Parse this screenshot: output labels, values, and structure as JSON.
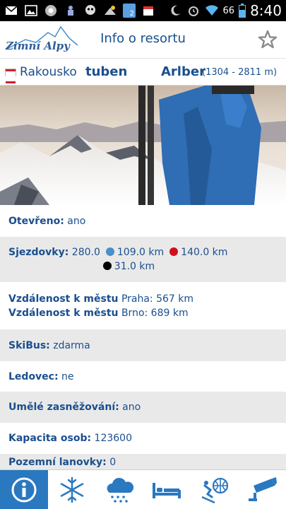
{
  "status_bar": {
    "time": "8:40",
    "battery": "66",
    "notif_badge": "2"
  },
  "header": {
    "logo_text": "Zimní Alpy",
    "title": "Info o resortu"
  },
  "location": {
    "country": "Rakousko",
    "month": "tuben",
    "resort": "Arlber",
    "elevation": "(1304 - 2811 m)"
  },
  "info": {
    "open_label": "Otevřeno:",
    "open_value": "ano",
    "slopes_label": "Sjezdovky:",
    "slopes_total": "280.0",
    "slopes_blue": "109.0 km",
    "slopes_red": "140.0 km",
    "slopes_black": "31.0 km",
    "distance_label": "Vzdálenost k městu",
    "distance_1": "Praha: 567 km",
    "distance_2": "Brno: 689 km",
    "skibus_label": "SkiBus:",
    "skibus_value": "zdarma",
    "glacier_label": "Ledovec:",
    "glacier_value": "ne",
    "snowmaking_label": "Umělé zasněžování:",
    "snowmaking_value": "ano",
    "capacity_label": "Kapacita osob:",
    "capacity_value": "123600",
    "lifts_label": "Pozemní lanovky:",
    "lifts_value": "0"
  },
  "colors": {
    "brand": "#1a4f8e",
    "active_tab": "#2a78c0",
    "blue_slope": "#4a8fc8",
    "red_slope": "#d0101a",
    "black_slope": "#000000",
    "row_grey": "#e9e9e9"
  },
  "bottom_nav": [
    {
      "icon": "info-icon"
    },
    {
      "icon": "snowflake-icon"
    },
    {
      "icon": "snow-cloud-icon"
    },
    {
      "icon": "bed-icon"
    },
    {
      "icon": "skier-globe-icon"
    },
    {
      "icon": "webcam-icon"
    }
  ]
}
